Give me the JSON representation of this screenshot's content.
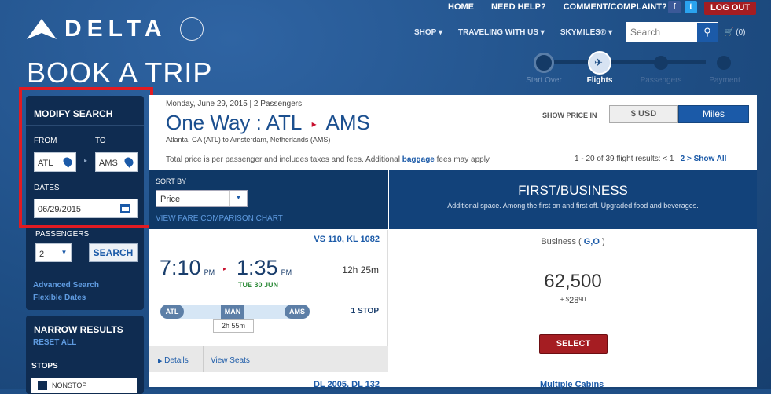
{
  "header": {
    "logo": "DELTA",
    "skyteam": "SKYTEAM",
    "top_links": [
      "HOME",
      "NEED HELP?",
      "COMMENT/COMPLAINT?"
    ],
    "logout": "LOG OUT",
    "nav": [
      "SHOP ▾",
      "TRAVELING WITH US ▾",
      "SKYMILES® ▾"
    ],
    "search_placeholder": "Search",
    "cart": "(0)"
  },
  "page_title": "BOOK A TRIP",
  "steps": [
    {
      "label": "Start Over"
    },
    {
      "label": "Flights"
    },
    {
      "label": "Passengers"
    },
    {
      "label": "Payment"
    }
  ],
  "sidebar": {
    "modify": "MODIFY SEARCH",
    "from_label": "FROM",
    "to_label": "TO",
    "from": "ATL",
    "to": "AMS",
    "dates_label": "DATES",
    "date": "06/29/2015",
    "passengers_label": "PASSENGERS",
    "passengers": "2",
    "search": "SEARCH",
    "advanced": "Advanced Search",
    "flexible": "Flexible Dates",
    "narrow": "NARROW RESULTS",
    "reset": "RESET ALL",
    "stops": "STOPS",
    "nonstop": "NONSTOP"
  },
  "trip": {
    "date_line": "Monday, June 29, 2015 | 2 Passengers",
    "title_prefix": "One Way : ATL",
    "title_dest": "AMS",
    "subtitle": "Atlanta, GA (ATL) to Amsterdam, Netherlands (AMS)",
    "show_price": "SHOW PRICE IN",
    "usd": "$ USD",
    "miles": "Miles",
    "note_pre": "Total price is per passenger and includes taxes and fees. Additional",
    "note_link": "baggage",
    "note_post": "fees may apply.",
    "results": "1 - 20 of 39 flight results: < 1 |",
    "page2": "2 >",
    "show_all": "Show All"
  },
  "sort": {
    "label": "SORT BY",
    "value": "Price",
    "compare": "VIEW FARE COMPARISON CHART"
  },
  "cabin": {
    "title": "FIRST/BUSINESS",
    "desc": "Additional space. Among the first on and first off. Upgraded food and beverages."
  },
  "flight": {
    "number": "VS 110, KL 1082",
    "dep": "7:10",
    "dep_ampm": "PM",
    "arr": "1:35",
    "arr_ampm": "PM",
    "arr_date": "TUE 30 JUN",
    "duration": "12h 25m",
    "route": [
      "ATL",
      "MAN",
      "AMS"
    ],
    "layover": "2h 55m",
    "stops": "1 STOP",
    "details": "Details",
    "seats": "View Seats",
    "fare_class": "Business (",
    "fare_codes": "G,O",
    "fare_close": ")",
    "miles": "62,500",
    "tax_plus": "+ $",
    "tax_dollars": "28",
    "tax_cents": "90",
    "select": "SELECT"
  },
  "next_flight": {
    "number": "DL 2005, DL 132",
    "cabin": "Multiple Cabins"
  },
  "colors": {
    "accent": "#1b5aa8",
    "red": "#a51d22",
    "navy": "#0f3866"
  }
}
